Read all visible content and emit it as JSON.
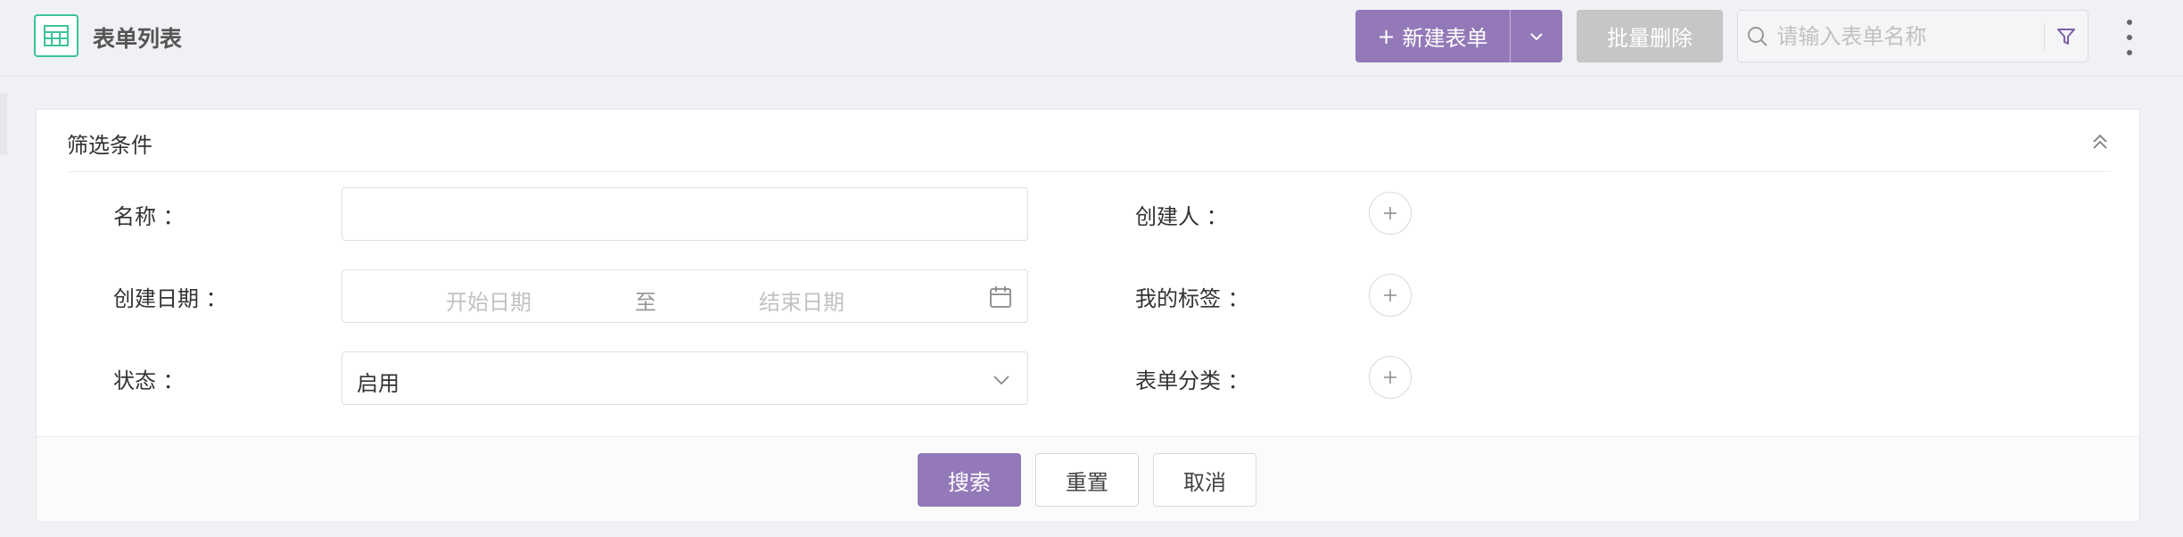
{
  "header": {
    "title": "表单列表",
    "new_button_label": "新建表单",
    "new_button_plus": "+",
    "batch_delete_label": "批量删除",
    "search_placeholder": "请输入表单名称"
  },
  "filter": {
    "title": "筛选条件",
    "name_label": "名称 ：",
    "name_value": "",
    "creator_label": "创建人 ：",
    "date_label": "创建日期 ：",
    "date_start_placeholder": "开始日期",
    "date_to": "至",
    "date_end_placeholder": "结束日期",
    "tags_label": "我的标签 ：",
    "status_label": "状态 ：",
    "status_value": "启用",
    "category_label": "表单分类 ："
  },
  "actions": {
    "search": "搜索",
    "reset": "重置",
    "cancel": "取消"
  },
  "colors": {
    "primary": "#9479b9",
    "logo_green": "#3ec29b",
    "disabled": "#c6c6c6"
  },
  "icons": [
    "table-icon",
    "chevron-down-icon",
    "search-icon",
    "filter-icon",
    "more-icon",
    "collapse-up-icon",
    "calendar-icon",
    "plus-icon"
  ]
}
